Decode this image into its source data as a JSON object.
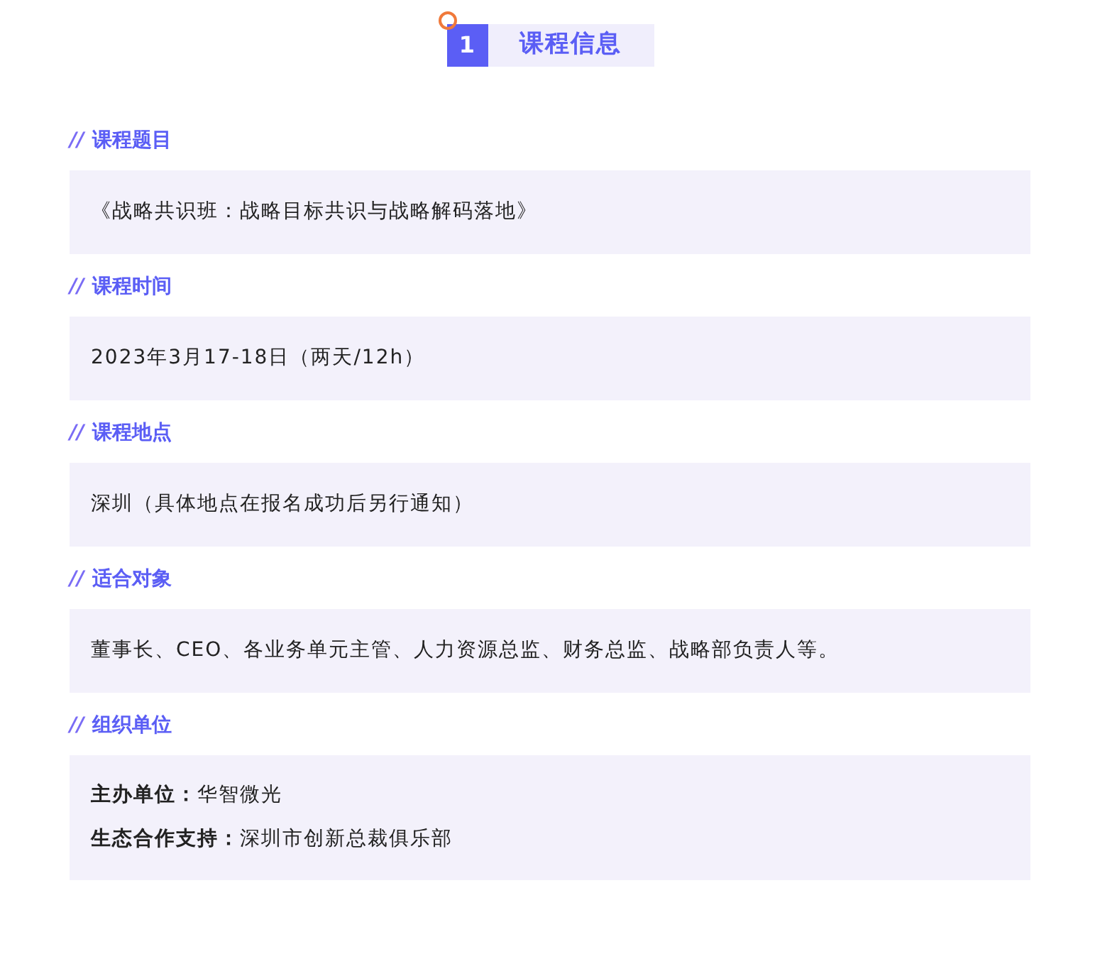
{
  "header": {
    "number": "1",
    "title": "课程信息"
  },
  "sections": [
    {
      "marker": "//",
      "heading": "课程题目",
      "lines": [
        "《战略共识班：战略目标共识与战略解码落地》"
      ]
    },
    {
      "marker": "//",
      "heading": "课程时间",
      "lines": [
        "2023年3月17-18日（两天/12h）"
      ]
    },
    {
      "marker": "//",
      "heading": "课程地点",
      "lines": [
        "深圳（具体地点在报名成功后另行通知）"
      ]
    },
    {
      "marker": "//",
      "heading": "适合对象",
      "lines": [
        "董事长、CEO、各业务单元主管、人力资源总监、财务总监、战略部负责人等。"
      ]
    },
    {
      "marker": "//",
      "heading": "组织单位",
      "lines": [
        "**主办单位：**华智微光",
        "**生态合作支持：**深圳市创新总裁俱乐部"
      ]
    }
  ]
}
